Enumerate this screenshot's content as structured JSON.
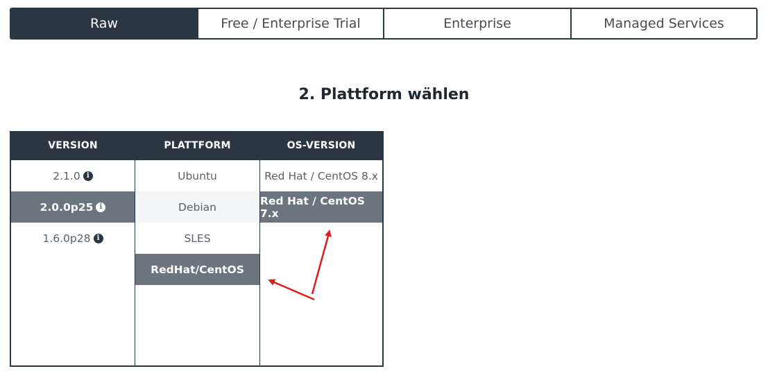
{
  "tabs": [
    {
      "label": "Raw",
      "active": true
    },
    {
      "label": "Free / Enterprise Trial",
      "active": false
    },
    {
      "label": "Enterprise",
      "active": false
    },
    {
      "label": "Managed Services",
      "active": false
    }
  ],
  "heading": "2. Plattform wählen",
  "columns": {
    "version": {
      "header": "VERSION",
      "items": [
        {
          "label": "2.1.0",
          "info_icon": "info-icon"
        },
        {
          "label": "2.0.0p25",
          "info_icon": "info-icon",
          "selected": true
        },
        {
          "label": "1.6.0p28",
          "info_icon": "info-icon"
        }
      ]
    },
    "platform": {
      "header": "PLATTFORM",
      "items": [
        {
          "label": "Ubuntu"
        },
        {
          "label": "Debian"
        },
        {
          "label": "SLES"
        },
        {
          "label": "RedHat/CentOS",
          "selected": true
        }
      ]
    },
    "os_version": {
      "header": "OS-VERSION",
      "items": [
        {
          "label": "Red Hat / CentOS 8.x"
        },
        {
          "label": "Red Hat / CentOS 7.x",
          "selected": true
        }
      ]
    }
  },
  "info_glyph": "i",
  "colors": {
    "dark": "#2b3643",
    "selected": "#6c757e",
    "annotation_arrow": "#e3191c"
  }
}
